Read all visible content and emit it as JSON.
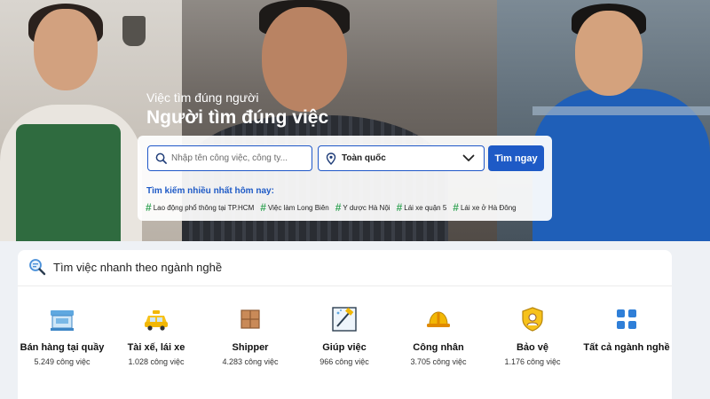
{
  "hero": {
    "tagline_small": "Việc tìm đúng người",
    "tagline_big": "Người tìm đúng việc"
  },
  "search": {
    "input_placeholder": "Nhập tên công việc, công ty...",
    "input_value": "",
    "location_value": "Toàn quốc",
    "button_label": "Tìm ngay",
    "icons": {
      "search": "search-icon",
      "location": "location-pin-icon",
      "dropdown": "chevron-down-icon"
    }
  },
  "trending": {
    "title": "Tìm kiếm nhiều nhất hôm nay:",
    "tags": [
      "Lao động phổ thông tại TP.HCM",
      "Việc làm Long Biên",
      "Y dược Hà Nội",
      "Lái xe quận 5",
      "Lái xe ở Hà Đông"
    ]
  },
  "categories": {
    "title": "Tìm việc nhanh theo ngành nghề",
    "icon": "magnifier-icon",
    "items": [
      {
        "name": "Bán hàng tại quầy",
        "count": "5.249 công việc",
        "icon": "shop-counter-icon"
      },
      {
        "name": "Tài xế, lái xe",
        "count": "1.028 công việc",
        "icon": "taxi-icon"
      },
      {
        "name": "Shipper",
        "count": "4.283 công việc",
        "icon": "boxes-icon"
      },
      {
        "name": "Giúp việc",
        "count": "966 công việc",
        "icon": "cleaning-icon"
      },
      {
        "name": "Công nhân",
        "count": "3.705 công việc",
        "icon": "hard-hat-icon"
      },
      {
        "name": "Bảo vệ",
        "count": "1.176 công việc",
        "icon": "guard-badge-icon"
      },
      {
        "name": "Tất cả ngành nghề",
        "count": "",
        "icon": "grid-icon"
      }
    ]
  },
  "colors": {
    "primary": "#1e5ac6",
    "tag_hash": "#3aa65a"
  }
}
